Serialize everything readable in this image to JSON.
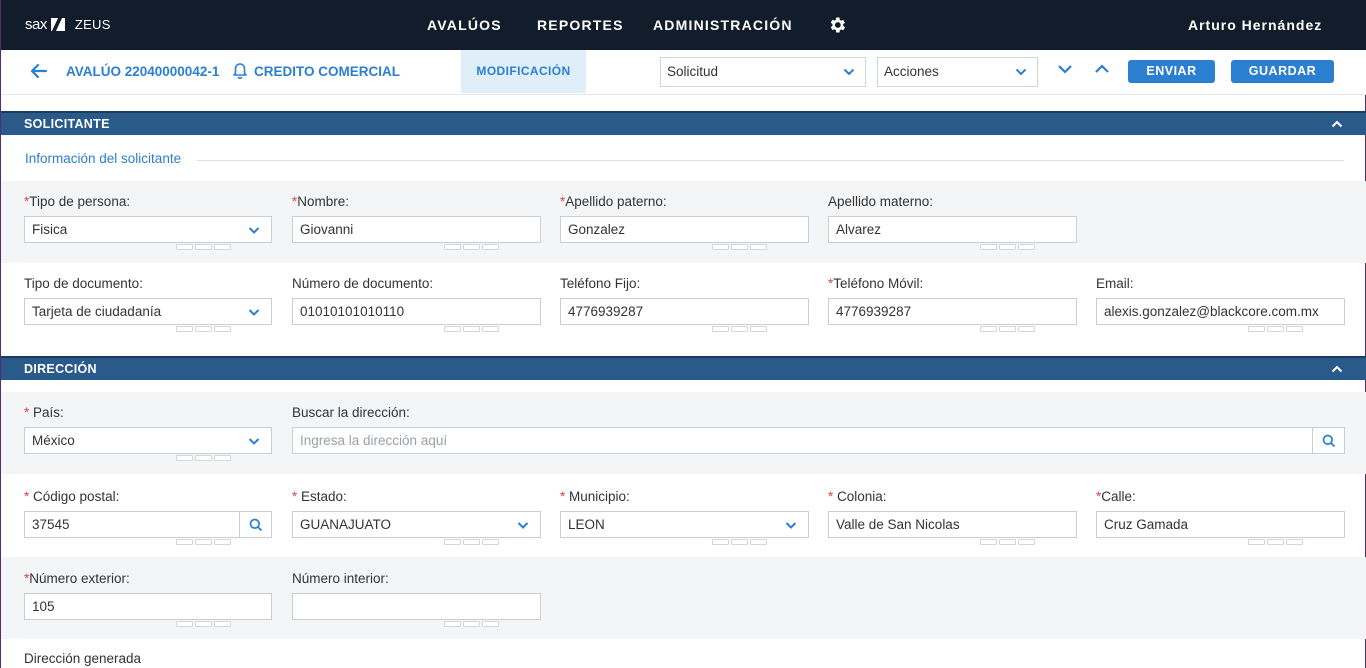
{
  "header": {
    "logo_text": "sax",
    "app_name": "ZEUS",
    "nav": [
      "AVALÚOS",
      "REPORTES",
      "ADMINISTRACIÓN"
    ],
    "user": "Arturo Hernández"
  },
  "toolbar": {
    "record": "AVALÚO 22040000042-1",
    "credit": "CREDITO COMERCIAL",
    "mode_tab": "MODIFICACIÓN",
    "select_solicitud": "Solicitud",
    "select_acciones": "Acciones",
    "send_label": "ENVIAR",
    "save_label": "GUARDAR"
  },
  "solicitante": {
    "title": "SOLICITANTE",
    "subtitle": "Información del solicitante",
    "tipo_persona": {
      "label": "Tipo de persona:",
      "value": "Fisica",
      "required": true
    },
    "nombre": {
      "label": "Nombre:",
      "value": "Giovanni",
      "required": true
    },
    "apellido_paterno": {
      "label": "Apellido paterno:",
      "value": "Gonzalez",
      "required": true
    },
    "apellido_materno": {
      "label": "Apellido materno:",
      "value": "Alvarez",
      "required": false
    },
    "tipo_documento": {
      "label": "Tipo de documento:",
      "value": "Tarjeta de ciudadanía",
      "required": false
    },
    "numero_documento": {
      "label": "Número de documento:",
      "value": "01010101010110",
      "required": false
    },
    "telefono_fijo": {
      "label": "Teléfono Fijo:",
      "value": "4776939287",
      "required": false
    },
    "telefono_movil": {
      "label": "Teléfono Móvil:",
      "value": "4776939287",
      "required": true
    },
    "email": {
      "label": "Email:",
      "value": "alexis.gonzalez@blackcore.com.mx",
      "required": false
    }
  },
  "direccion": {
    "title": "DIRECCIÓN",
    "pais": {
      "label": " País:",
      "value": "México",
      "required": true
    },
    "buscar": {
      "label": "Buscar la dirección:",
      "placeholder": "Ingresa la dirección aquí"
    },
    "codigo_postal": {
      "label": " Código postal:",
      "value": "37545",
      "required": true
    },
    "estado": {
      "label": " Estado:",
      "value": "GUANAJUATO",
      "required": true
    },
    "municipio": {
      "label": " Municipio:",
      "value": "LEON",
      "required": true
    },
    "colonia": {
      "label": " Colonia:",
      "value": "Valle de San Nicolas",
      "required": true
    },
    "calle": {
      "label": "Calle:",
      "value": "Cruz Gamada",
      "required": true
    },
    "numero_exterior": {
      "label": "Número exterior:",
      "value": "105",
      "required": true
    },
    "numero_interior": {
      "label": "Número interior:",
      "value": "",
      "required": false
    },
    "generada_label": "Dirección generada"
  },
  "colors": {
    "navbar": "#111d2b",
    "accent": "#2b7fd1",
    "section_header": "#2a5a8a",
    "required": "#e0443c"
  }
}
